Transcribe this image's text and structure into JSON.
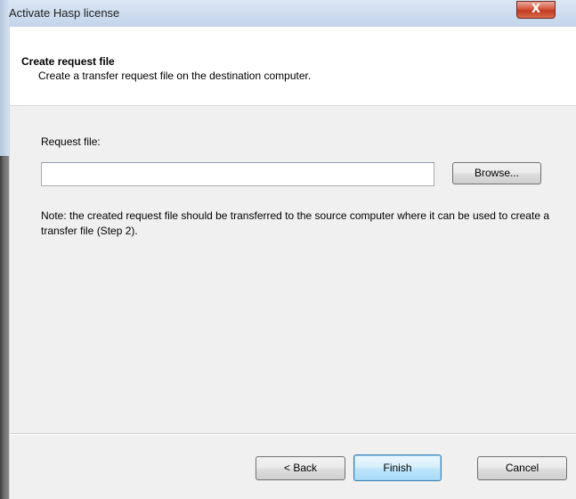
{
  "window": {
    "title": "Activate Hasp license",
    "close_glyph": "X"
  },
  "header": {
    "title": "Create request file",
    "subtitle": "Create a transfer request file on the destination computer."
  },
  "form": {
    "request_file_label": "Request file:",
    "request_file_value": "",
    "browse_label": "Browse...",
    "note": "Note: the created request file should be transferred to the source computer where it can be used to create a transfer file (Step 2)."
  },
  "footer": {
    "back_label": "< Back",
    "finish_label": "Finish",
    "cancel_label": "Cancel"
  }
}
